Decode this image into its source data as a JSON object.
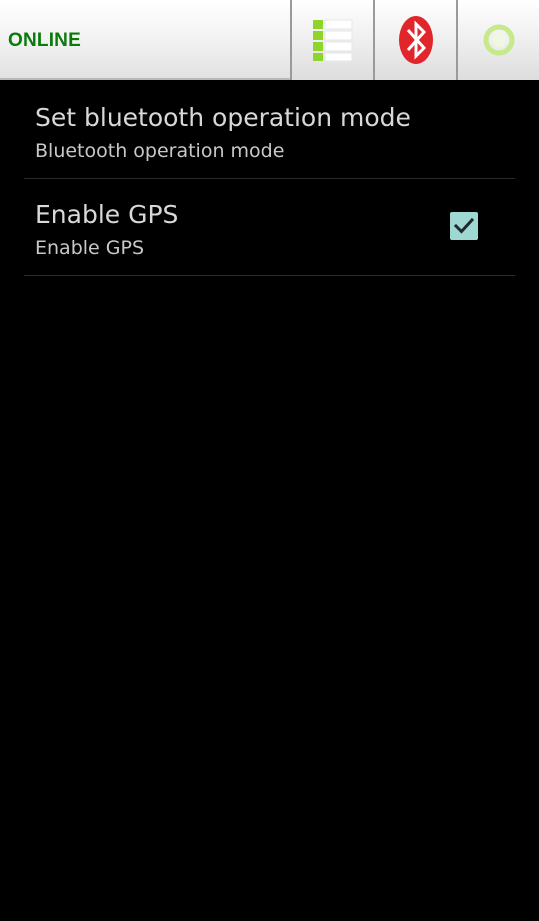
{
  "header": {
    "status_text": "ONLINE",
    "status_color": "#0b7a0b",
    "buttons": [
      {
        "name": "signal-strength-icon",
        "color": "#8ed42a"
      },
      {
        "name": "bluetooth-icon",
        "color": "#e0262b"
      },
      {
        "name": "gps-status-icon",
        "color": "#c6e98a"
      }
    ]
  },
  "preferences": [
    {
      "title": "Set bluetooth operation mode",
      "summary": "Bluetooth operation mode"
    },
    {
      "title": "Enable GPS",
      "summary": "Enable GPS",
      "checked": true,
      "checkbox_color": "#9fd8d2"
    }
  ]
}
